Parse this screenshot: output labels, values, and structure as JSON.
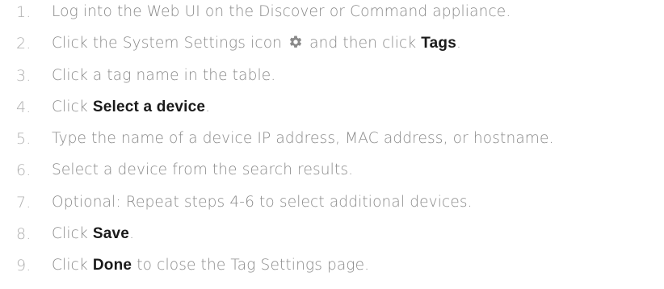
{
  "steps": [
    {
      "number": "1.",
      "text": "Log into the Web UI on the Discover or Command appliance."
    },
    {
      "number": "2.",
      "before": "Click the System Settings icon",
      "icon": "gear-icon",
      "middle": "and then click",
      "bold": "Tags",
      "after": "."
    },
    {
      "number": "3.",
      "text": "Click a tag name in the table."
    },
    {
      "number": "4.",
      "before": "Click",
      "bold": "Select a device",
      "after": "."
    },
    {
      "number": "5.",
      "text": "Type the name of a device IP address, MAC address, or hostname."
    },
    {
      "number": "6.",
      "text": "Select a device from the search results."
    },
    {
      "number": "7.",
      "text": "Optional: Repeat steps 4-6 to select additional devices."
    },
    {
      "number": "8.",
      "before": "Click",
      "bold": "Save",
      "after": "."
    },
    {
      "number": "9.",
      "before": "Click",
      "bold": "Done",
      "after": "to close the Tag Settings page."
    }
  ],
  "colors": {
    "number": "#b0b0b0",
    "text": "#8a8a8a",
    "bold": "#1a1a1a",
    "icon": "#8a8a8a"
  }
}
